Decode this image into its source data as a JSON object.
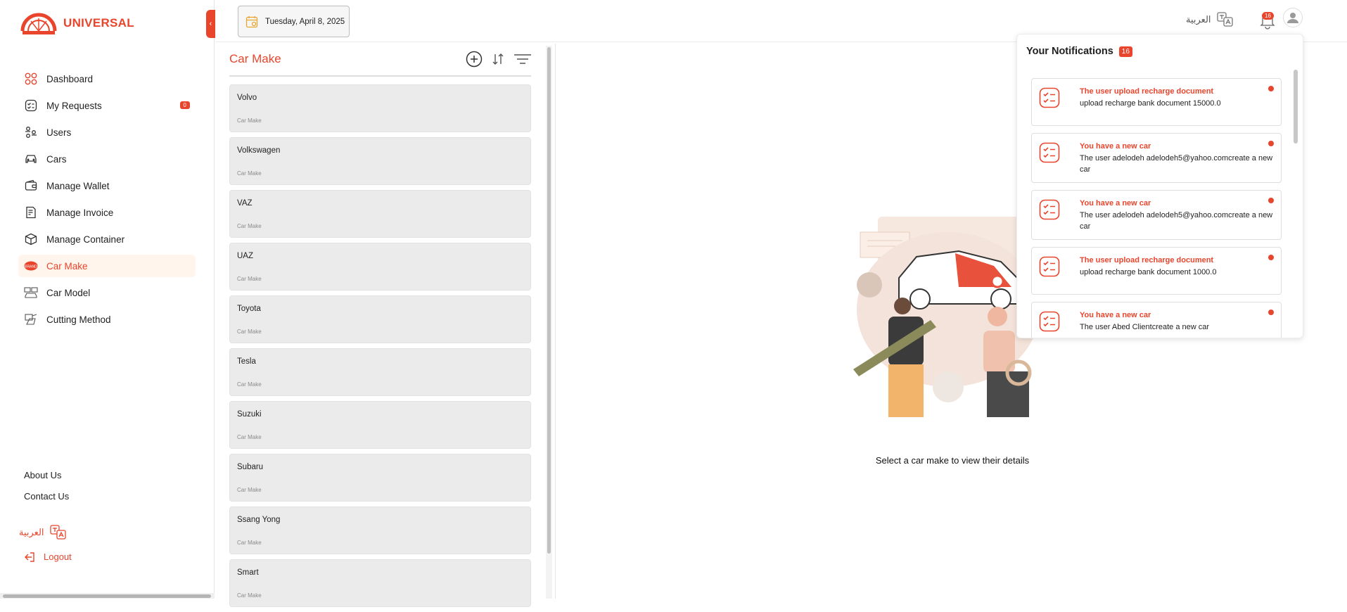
{
  "brand": {
    "name": "UNIVERSAL",
    "accent": "#e8452c"
  },
  "sidebar": {
    "items": [
      {
        "label": "Dashboard",
        "icon": "grid-icon"
      },
      {
        "label": "My Requests",
        "icon": "requests-icon",
        "badge": "0"
      },
      {
        "label": "Users",
        "icon": "users-icon"
      },
      {
        "label": "Cars",
        "icon": "car-icon"
      },
      {
        "label": "Manage Wallet",
        "icon": "wallet-icon"
      },
      {
        "label": "Manage Invoice",
        "icon": "invoice-icon"
      },
      {
        "label": "Manage Container",
        "icon": "container-icon"
      },
      {
        "label": "Car Make",
        "icon": "car-make-icon",
        "active": true
      },
      {
        "label": "Car Model",
        "icon": "car-model-icon"
      },
      {
        "label": "Cutting Method",
        "icon": "cutting-icon"
      }
    ],
    "about": "About Us",
    "contact": "Contact Us",
    "language": "العربية",
    "logout": "Logout"
  },
  "topbar": {
    "date": "Tuesday, April 8, 2025",
    "language": "العربية",
    "notification_count": "16"
  },
  "panel": {
    "title": "Car Make",
    "items": [
      {
        "name": "Volvo",
        "sub": "Car Make"
      },
      {
        "name": "Volkswagen",
        "sub": "Car Make"
      },
      {
        "name": "VAZ",
        "sub": "Car Make"
      },
      {
        "name": "UAZ",
        "sub": "Car Make"
      },
      {
        "name": "Toyota",
        "sub": "Car Make"
      },
      {
        "name": "Tesla",
        "sub": "Car Make"
      },
      {
        "name": "Suzuki",
        "sub": "Car Make"
      },
      {
        "name": "Subaru",
        "sub": "Car Make"
      },
      {
        "name": "Ssang Yong",
        "sub": "Car Make"
      },
      {
        "name": "Smart",
        "sub": "Car Make"
      }
    ]
  },
  "empty_state": {
    "text": "Select a car make to view their details"
  },
  "notifications": {
    "title": "Your Notifications",
    "count": "16",
    "items": [
      {
        "title": "The user upload recharge document",
        "body": "upload recharge bank document 15000.0"
      },
      {
        "title": "You have a new car",
        "body": "The user adelodeh adelodeh5@yahoo.comcreate a new car"
      },
      {
        "title": "You have a new car",
        "body": "The user adelodeh adelodeh5@yahoo.comcreate a new car"
      },
      {
        "title": "The user upload recharge document",
        "body": "upload recharge bank document 1000.0"
      },
      {
        "title": "You have a new car",
        "body": "The user Abed Clientcreate a new car"
      }
    ]
  }
}
